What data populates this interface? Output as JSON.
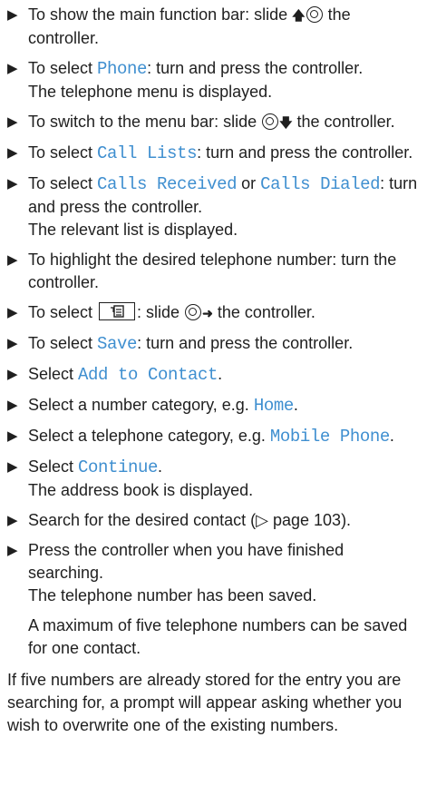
{
  "steps": [
    {
      "before": "To show the main function bar: slide ",
      "icon": "arrow-up-controller-icon",
      "after": " the controller."
    },
    {
      "before": "To select ",
      "ui": "Phone",
      "after": ": turn and press the controller.",
      "result": "The telephone menu is displayed."
    },
    {
      "before": "To switch to the menu bar: slide ",
      "icon": "controller-arrow-down-icon",
      "after": " the controller."
    },
    {
      "before": "To select ",
      "ui": "Call Lists",
      "after": ": turn and press the controller."
    },
    {
      "before": "To select ",
      "ui": "Calls Received",
      "mid": " or ",
      "ui2": "Calls Dialed",
      "after": ": turn and press the controller.",
      "result": "The relevant list is displayed."
    },
    {
      "before": "To highlight the desired telephone number: turn the controller."
    },
    {
      "before": "To select ",
      "icon": "menu-symbol-icon",
      "mid": ": slide ",
      "icon2": "controller-arrow-right-icon",
      "after": " the controller."
    },
    {
      "before": "To select ",
      "ui": "Save",
      "after": ": turn and press the controller."
    },
    {
      "before": "Select ",
      "ui": "Add to Contact",
      "after": "."
    },
    {
      "before": "Select a number category, e.g. ",
      "ui": "Home",
      "after": "."
    },
    {
      "before": "Select a telephone category, e.g. ",
      "ui": "Mobile Phone",
      "after": "."
    },
    {
      "before": "Select ",
      "ui": "Continue",
      "after": ".",
      "result": "The address book is displayed."
    },
    {
      "before": "Search for the desired contact (",
      "page_ref": "▷ page 103",
      "after": ")."
    },
    {
      "before": "Press the controller when you have finished searching.",
      "result": "The telephone number has been saved.",
      "note": "A maximum of five telephone numbers can be saved for one contact."
    }
  ],
  "closing_paragraph": "If five numbers are already stored for the entry you are searching for, a prompt will appear asking whether you wish to overwrite one of the existing numbers.",
  "colors": {
    "ui_text": "#3f8fd0",
    "body_text": "#1f1f1f"
  }
}
